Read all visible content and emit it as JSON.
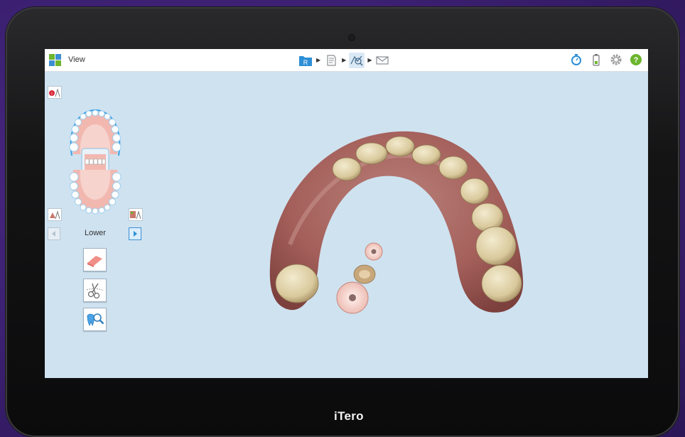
{
  "brand": "iTero",
  "app": {
    "title": "View",
    "steps": [
      {
        "name": "rx-folder-icon",
        "label": "R"
      },
      {
        "name": "scan-icon"
      },
      {
        "name": "view-icon",
        "active": true
      },
      {
        "name": "send-icon"
      }
    ],
    "right_icons": [
      "timer-icon",
      "battery-icon",
      "settings-gear-icon",
      "help-icon"
    ]
  },
  "left_panel": {
    "jaw_label": "Lower",
    "tools": [
      "eraser-tool-icon",
      "trim-scissors-tool-icon",
      "tooth-magnifier-tool-icon"
    ]
  },
  "colors": {
    "accent": "#3d8fd3",
    "screen_bg": "#cfe2f0",
    "help_green": "#6cb52d"
  }
}
